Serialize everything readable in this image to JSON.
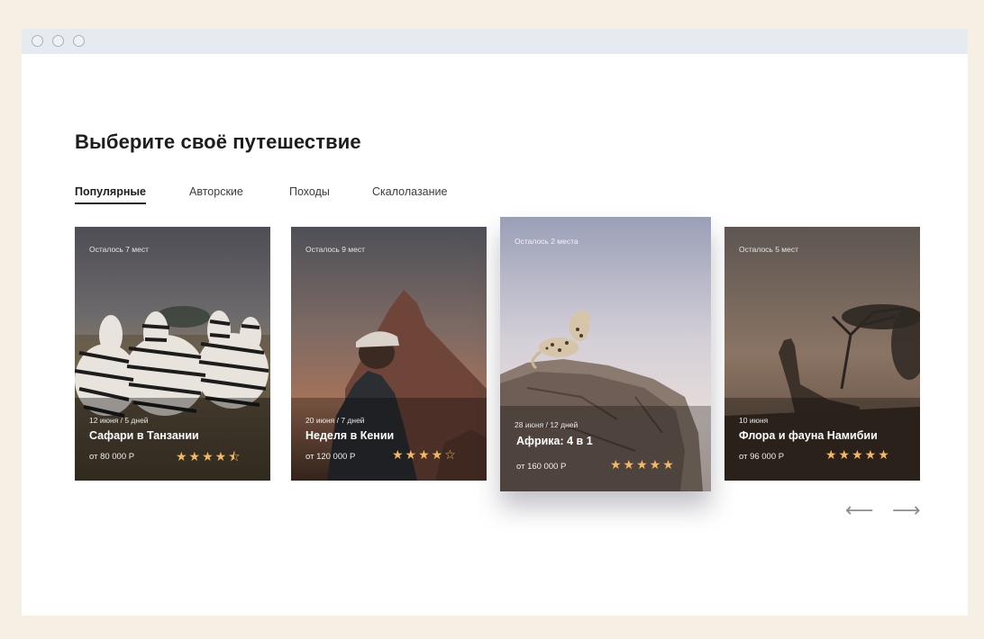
{
  "page": {
    "heading": "Выберите своё путешествие"
  },
  "tabs": [
    {
      "label": "Популярные",
      "active": true
    },
    {
      "label": "Авторские",
      "active": false
    },
    {
      "label": "Походы",
      "active": false
    },
    {
      "label": "Скалолазание",
      "active": false
    }
  ],
  "cards": [
    {
      "seats": "Осталось 7 мест",
      "date": "12 июня / 5 дней",
      "title": "Сафари в Танзании",
      "price": "от 80 000 Р",
      "rating": 4.5,
      "stars": "★★★★⯪"
    },
    {
      "seats": "Осталось 9 мест",
      "date": "20 июня / 7 дней",
      "title": "Неделя в Кении",
      "price": "от 120 000 Р",
      "rating": 4,
      "stars": "★★★★☆"
    },
    {
      "seats": "Осталось 2 места",
      "date": "28 июня / 12 дней",
      "title": "Африка: 4 в 1",
      "price": "от 160 000 Р",
      "rating": 5,
      "stars": "★★★★★"
    },
    {
      "seats": "Осталось 5 мест",
      "date": "10 июня",
      "title": "Флора и фауна Намибии",
      "price": "от 96 000 Р",
      "rating": 5,
      "stars": "★★★★★"
    }
  ],
  "nav": {
    "prev_icon": "arrow-left-icon",
    "next_icon": "arrow-right-icon",
    "prev": "⟵",
    "next": "⟶"
  },
  "colors": {
    "page_bg": "#f5efe4",
    "titlebar": "#e6ebf1",
    "star": "#f4b860"
  }
}
